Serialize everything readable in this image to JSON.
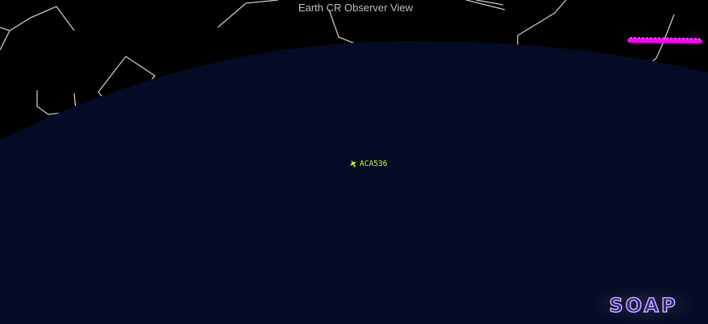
{
  "view": {
    "title": "Earth CR Observer View"
  },
  "colors": {
    "sky": "#000000",
    "earth": "#050a26",
    "constellation_lines": "#c8c8c8",
    "aircraft": "#c8ff1e",
    "marker": "#ff00ff",
    "logo_fill": "#3a1d8c",
    "logo_stroke": "#d7c8ff"
  },
  "icons": {
    "aircraft": "airplane-icon",
    "logo": "soap-logo"
  },
  "aircraft": [
    {
      "callsign": "ACA536"
    }
  ],
  "logo": {
    "text": "SOAP"
  }
}
